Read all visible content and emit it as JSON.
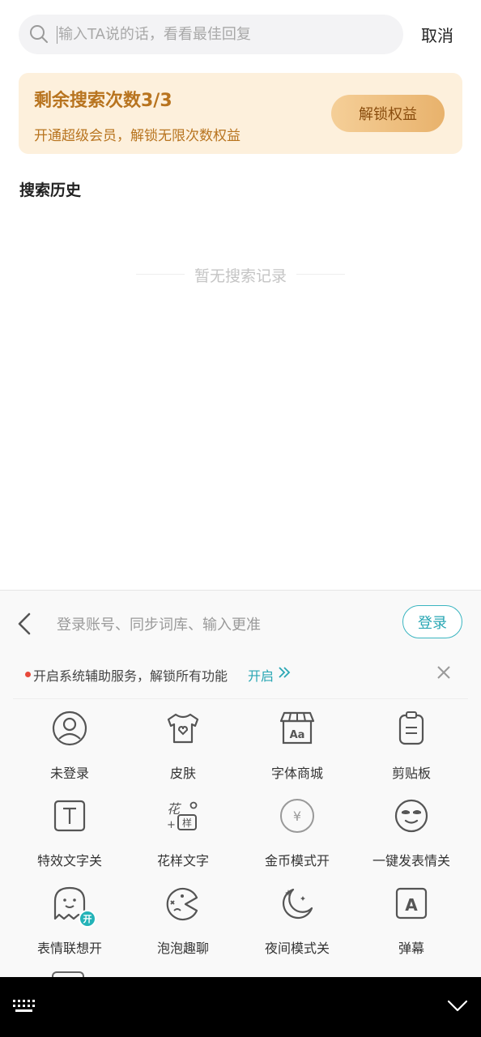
{
  "search": {
    "placeholder": "输入TA说的话，看看最佳回复",
    "cancel_label": "取消"
  },
  "promo": {
    "title": "剩余搜索次数3/3",
    "subtitle": "开通超级会员，解锁无限次数权益",
    "button_label": "解锁权益"
  },
  "history": {
    "title": "搜索历史",
    "empty_text": "暂无搜索记录"
  },
  "keyboard": {
    "hint": "登录账号、同步词库、输入更准",
    "login_label": "登录",
    "notice": {
      "text": "开启系统辅助服务，解锁所有功能",
      "action_label": "开启"
    },
    "tools": [
      {
        "label": "未登录",
        "icon": "user-icon"
      },
      {
        "label": "皮肤",
        "icon": "tshirt-icon"
      },
      {
        "label": "字体商城",
        "icon": "font-store-icon"
      },
      {
        "label": "剪贴板",
        "icon": "clipboard-icon"
      },
      {
        "label": "特效文字关",
        "icon": "text-effect-icon"
      },
      {
        "label": "花样文字",
        "icon": "fancy-text-icon"
      },
      {
        "label": "金币模式开",
        "icon": "coin-icon"
      },
      {
        "label": "一键发表情关",
        "icon": "emoji-face-icon"
      },
      {
        "label": "表情联想开",
        "icon": "ghost-icon",
        "badge": "开"
      },
      {
        "label": "泡泡趣聊",
        "icon": "bubble-chat-icon"
      },
      {
        "label": "夜间模式关",
        "icon": "moon-icon"
      },
      {
        "label": "弹幕",
        "icon": "danmaku-icon"
      }
    ]
  },
  "colors": {
    "accent": "#2aa7b4",
    "promo_text": "#b8741f",
    "promo_bg": "#fdf0dc"
  }
}
